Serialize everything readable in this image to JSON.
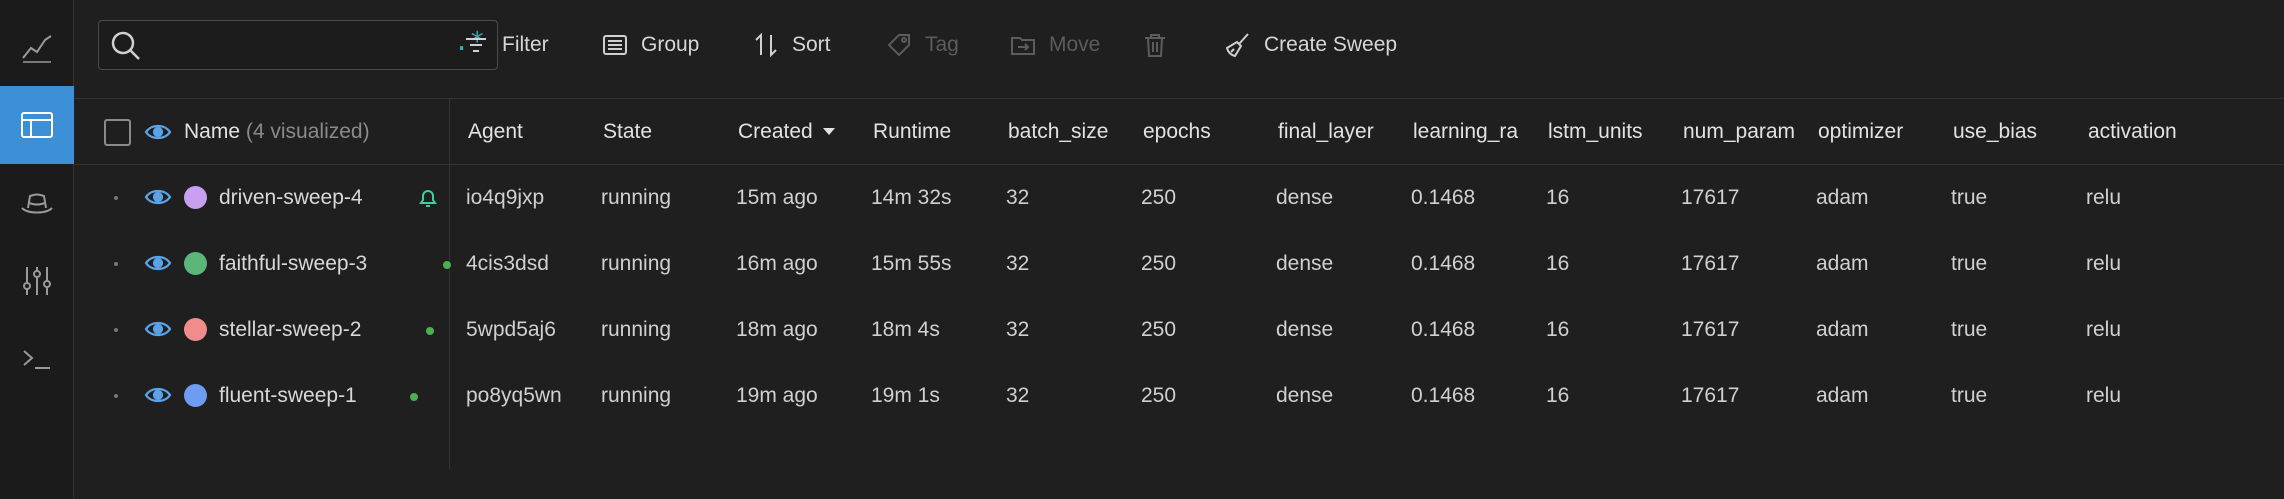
{
  "rail": {
    "icons": [
      "chart-line-icon",
      "table-icon",
      "hat-icon",
      "sliders-icon",
      "terminal-icon"
    ],
    "active": "table-icon",
    "accent": "#3d8fd6"
  },
  "search": {
    "value": "",
    "placeholder": "",
    "regex_label": ".*"
  },
  "toolbar": {
    "filter": "Filter",
    "group": "Group",
    "sort": "Sort",
    "tag": "Tag",
    "move": "Move",
    "create_sweep": "Create Sweep"
  },
  "table": {
    "name_header": "Name",
    "name_header_suffix": "(4 visualized)",
    "created_header": "Created",
    "columns": [
      "Agent",
      "State",
      "Created",
      "Runtime",
      "batch_size",
      "epochs",
      "final_layer",
      "learning_ra",
      "lstm_units",
      "num_param",
      "optimizer",
      "use_bias",
      "activation"
    ],
    "rows": [
      {
        "name": "driven-sweep-4",
        "color": "#c9a0f0",
        "agent": "io4q9jxp",
        "state": "running",
        "created": "15m ago",
        "runtime": "14m 32s",
        "batch_size": "32",
        "epochs": "250",
        "final_layer": "dense",
        "learning_rate": "0.1468",
        "lstm_units": "16",
        "num_params": "17617",
        "optimizer": "adam",
        "use_bias": "true",
        "activation": "relu",
        "marker": "bell"
      },
      {
        "name": "faithful-sweep-3",
        "color": "#5cb67a",
        "agent": "4cis3dsd",
        "state": "running",
        "created": "16m ago",
        "runtime": "15m 55s",
        "batch_size": "32",
        "epochs": "250",
        "final_layer": "dense",
        "learning_rate": "0.1468",
        "lstm_units": "16",
        "num_params": "17617",
        "optimizer": "adam",
        "use_bias": "true",
        "activation": "relu",
        "marker": "dot"
      },
      {
        "name": "stellar-sweep-2",
        "color": "#f08c8c",
        "agent": "5wpd5aj6",
        "state": "running",
        "created": "18m ago",
        "runtime": "18m 4s",
        "batch_size": "32",
        "epochs": "250",
        "final_layer": "dense",
        "learning_rate": "0.1468",
        "lstm_units": "16",
        "num_params": "17617",
        "optimizer": "adam",
        "use_bias": "true",
        "activation": "relu",
        "marker": "dot"
      },
      {
        "name": "fluent-sweep-1",
        "color": "#6f9cf0",
        "agent": "po8yq5wn",
        "state": "running",
        "created": "19m ago",
        "runtime": "19m 1s",
        "batch_size": "32",
        "epochs": "250",
        "final_layer": "dense",
        "learning_rate": "0.1468",
        "lstm_units": "16",
        "num_params": "17617",
        "optimizer": "adam",
        "use_bias": "true",
        "activation": "relu",
        "marker": "dot"
      }
    ]
  }
}
